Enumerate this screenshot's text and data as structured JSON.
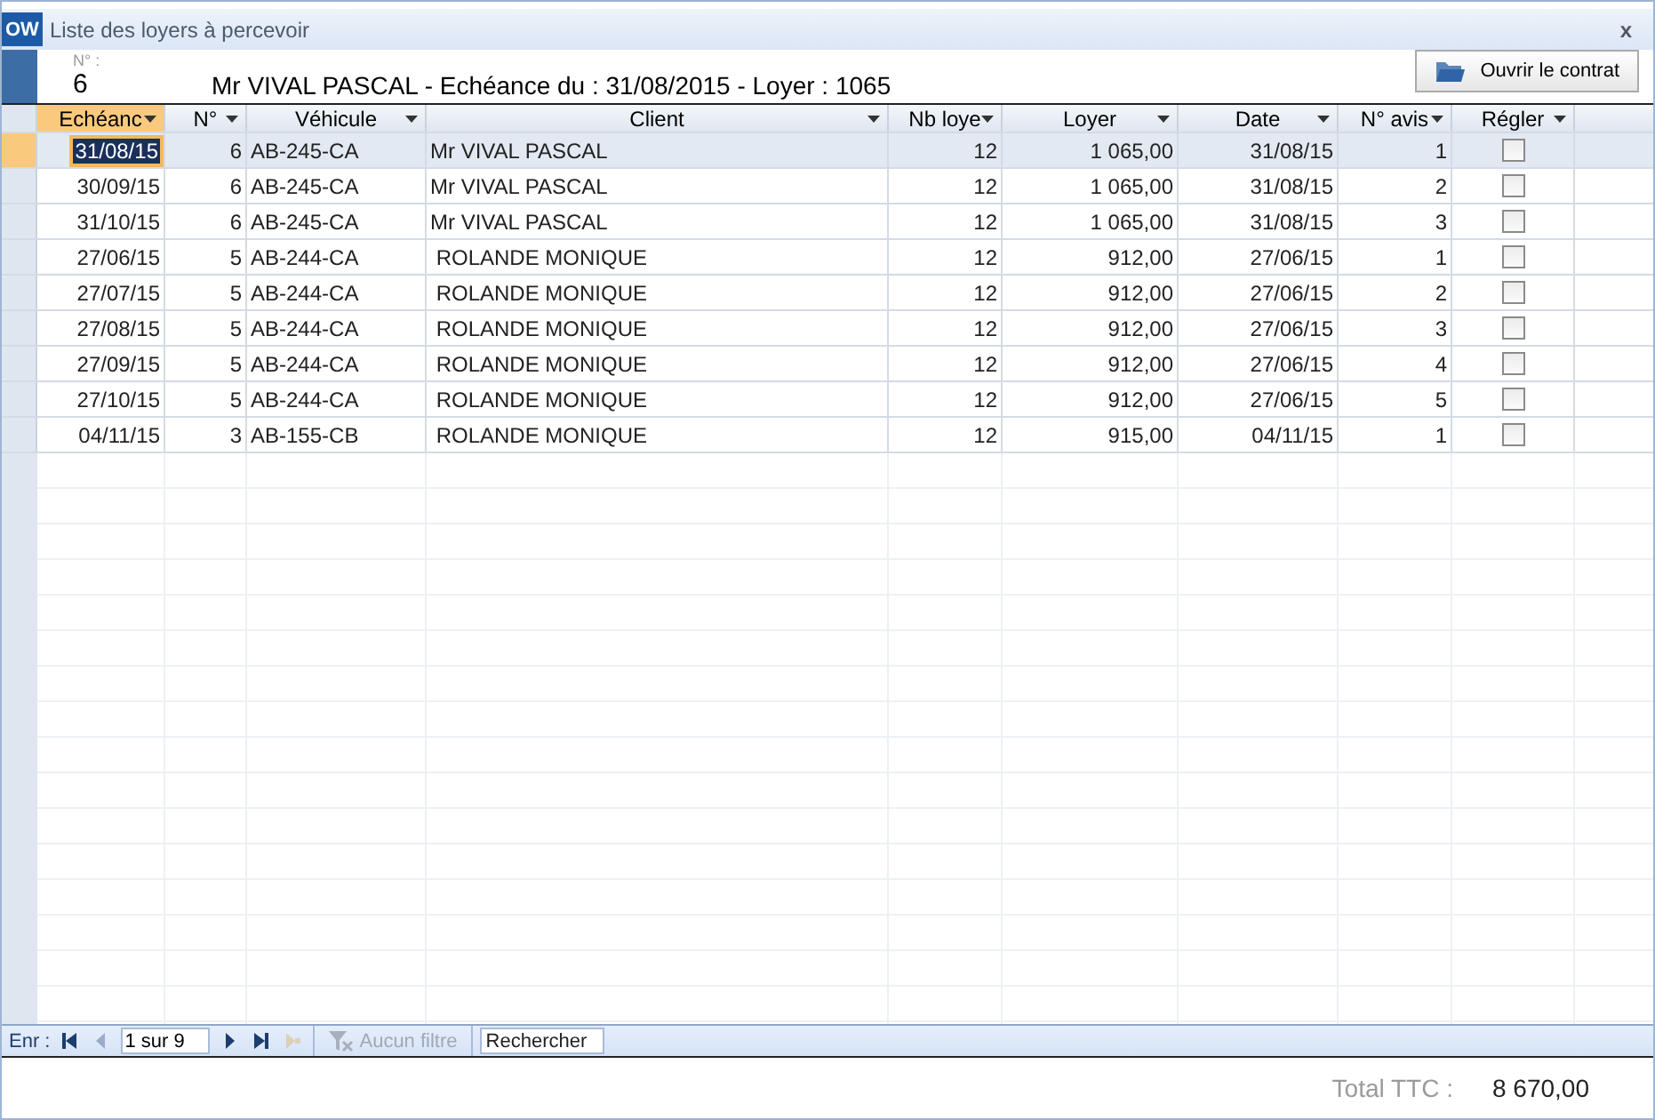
{
  "window": {
    "icon_text": "OW",
    "title": "Liste des loyers à percevoir",
    "close": "x"
  },
  "header": {
    "number_label": "N° :",
    "number": "6",
    "summary": "Mr VIVAL PASCAL - Echéance du : 31/08/2015 - Loyer : 1065",
    "open_button": "Ouvrir le contrat"
  },
  "table": {
    "columns": [
      {
        "label": "Echéanc",
        "active": true
      },
      {
        "label": "N°",
        "active": false
      },
      {
        "label": "Véhicule",
        "active": false
      },
      {
        "label": "Client",
        "active": false
      },
      {
        "label": "Nb loye",
        "active": false
      },
      {
        "label": "Loyer",
        "active": false
      },
      {
        "label": "Date",
        "active": false
      },
      {
        "label": "N° avis",
        "active": false
      },
      {
        "label": "Régler",
        "active": false
      }
    ],
    "rows": [
      {
        "selected": true,
        "echeance": "31/08/15",
        "no": "6",
        "vehicule": "AB-245-CA",
        "client": "Mr VIVAL PASCAL",
        "nb": "12",
        "loyer": "1 065,00",
        "date": "31/08/15",
        "avis": "1",
        "regler": false
      },
      {
        "selected": false,
        "echeance": "30/09/15",
        "no": "6",
        "vehicule": "AB-245-CA",
        "client": "Mr VIVAL PASCAL",
        "nb": "12",
        "loyer": "1 065,00",
        "date": "31/08/15",
        "avis": "2",
        "regler": false
      },
      {
        "selected": false,
        "echeance": "31/10/15",
        "no": "6",
        "vehicule": "AB-245-CA",
        "client": "Mr VIVAL PASCAL",
        "nb": "12",
        "loyer": "1 065,00",
        "date": "31/08/15",
        "avis": "3",
        "regler": false
      },
      {
        "selected": false,
        "echeance": "27/06/15",
        "no": "5",
        "vehicule": "AB-244-CA",
        "client": " ROLANDE MONIQUE",
        "nb": "12",
        "loyer": "912,00",
        "date": "27/06/15",
        "avis": "1",
        "regler": false
      },
      {
        "selected": false,
        "echeance": "27/07/15",
        "no": "5",
        "vehicule": "AB-244-CA",
        "client": " ROLANDE MONIQUE",
        "nb": "12",
        "loyer": "912,00",
        "date": "27/06/15",
        "avis": "2",
        "regler": false
      },
      {
        "selected": false,
        "echeance": "27/08/15",
        "no": "5",
        "vehicule": "AB-244-CA",
        "client": " ROLANDE MONIQUE",
        "nb": "12",
        "loyer": "912,00",
        "date": "27/06/15",
        "avis": "3",
        "regler": false
      },
      {
        "selected": false,
        "echeance": "27/09/15",
        "no": "5",
        "vehicule": "AB-244-CA",
        "client": " ROLANDE MONIQUE",
        "nb": "12",
        "loyer": "912,00",
        "date": "27/06/15",
        "avis": "4",
        "regler": false
      },
      {
        "selected": false,
        "echeance": "27/10/15",
        "no": "5",
        "vehicule": "AB-244-CA",
        "client": " ROLANDE MONIQUE",
        "nb": "12",
        "loyer": "912,00",
        "date": "27/06/15",
        "avis": "5",
        "regler": false
      },
      {
        "selected": false,
        "echeance": "04/11/15",
        "no": "3",
        "vehicule": "AB-155-CB",
        "client": " ROLANDE MONIQUE",
        "nb": "12",
        "loyer": "915,00",
        "date": "04/11/15",
        "avis": "1",
        "regler": false
      }
    ]
  },
  "navigation": {
    "label": "Enr :",
    "position": "1 sur 9",
    "filter": "Aucun filtre",
    "search": {
      "placeholder": "Rechercher"
    }
  },
  "footer": {
    "total_label": "Total TTC :",
    "total": "8 670,00"
  }
}
